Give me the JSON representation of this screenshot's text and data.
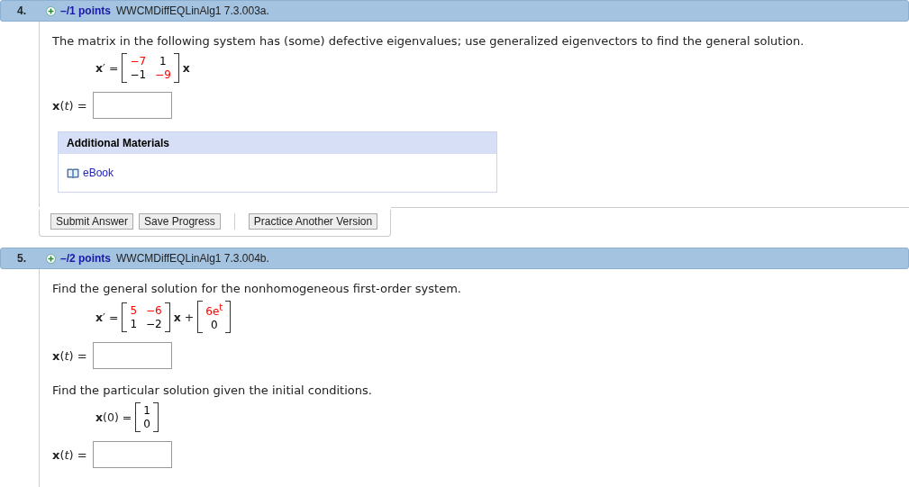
{
  "questions": [
    {
      "number": "4.",
      "points": "–/1 points",
      "code": "WWCMDiffEQLinAlg1 7.3.003a.",
      "parts": [
        {
          "kind": "text",
          "text": "The matrix in the following system has (some) defective eigenvalues; use generalized eigenvectors to find the general solution."
        },
        {
          "kind": "equation",
          "terms": [
            {
              "kind": "label",
              "text": "**x**′ ="
            },
            {
              "kind": "matrix",
              "rows": [
                [
                  {
                    "text": "−7",
                    "color": "#ff0000"
                  },
                  {
                    "text": "1",
                    "color": "#000000"
                  }
                ],
                [
                  {
                    "text": "−1",
                    "color": "#000000"
                  },
                  {
                    "text": "−9",
                    "color": "#ff0000"
                  }
                ]
              ]
            },
            {
              "kind": "label",
              "text": "**x**"
            }
          ]
        },
        {
          "kind": "answer",
          "label": "**x**(*t*) ="
        }
      ],
      "materials": {
        "title": "Additional Materials",
        "links": [
          "eBook"
        ]
      },
      "buttons": [
        "Submit Answer",
        "Save Progress"
      ],
      "extra_button": "Practice Another Version"
    },
    {
      "number": "5.",
      "points": "–/2 points",
      "code": "WWCMDiffEQLinAlg1 7.3.004b.",
      "parts": [
        {
          "kind": "text",
          "text": "Find the general solution for the nonhomogeneous first-order system."
        },
        {
          "kind": "equation",
          "terms": [
            {
              "kind": "label",
              "text": "**x**′ ="
            },
            {
              "kind": "matrix",
              "rows": [
                [
                  {
                    "text": "5",
                    "color": "#ff0000"
                  },
                  {
                    "text": "−6",
                    "color": "#ff0000"
                  }
                ],
                [
                  {
                    "text": "1",
                    "color": "#000000"
                  },
                  {
                    "text": "−2",
                    "color": "#000000"
                  }
                ]
              ]
            },
            {
              "kind": "label",
              "text": "**x** +"
            },
            {
              "kind": "matrix",
              "rows": [
                [
                  {
                    "text": "6e$^{t}$",
                    "color": "#ff0000"
                  }
                ],
                [
                  {
                    "text": "0",
                    "color": "#000000"
                  }
                ]
              ]
            }
          ]
        },
        {
          "kind": "answer",
          "label": "**x**(*t*) ="
        },
        {
          "kind": "text",
          "text": "Find the particular solution given the initial conditions."
        },
        {
          "kind": "equation",
          "terms": [
            {
              "kind": "label",
              "text": "**x**(0) ="
            },
            {
              "kind": "matrix",
              "rows": [
                [
                  {
                    "text": "1",
                    "color": "#000000"
                  }
                ],
                [
                  {
                    "text": "0",
                    "color": "#000000"
                  }
                ]
              ]
            }
          ]
        },
        {
          "kind": "answer",
          "label": "**x**(*t*) ="
        }
      ]
    }
  ]
}
